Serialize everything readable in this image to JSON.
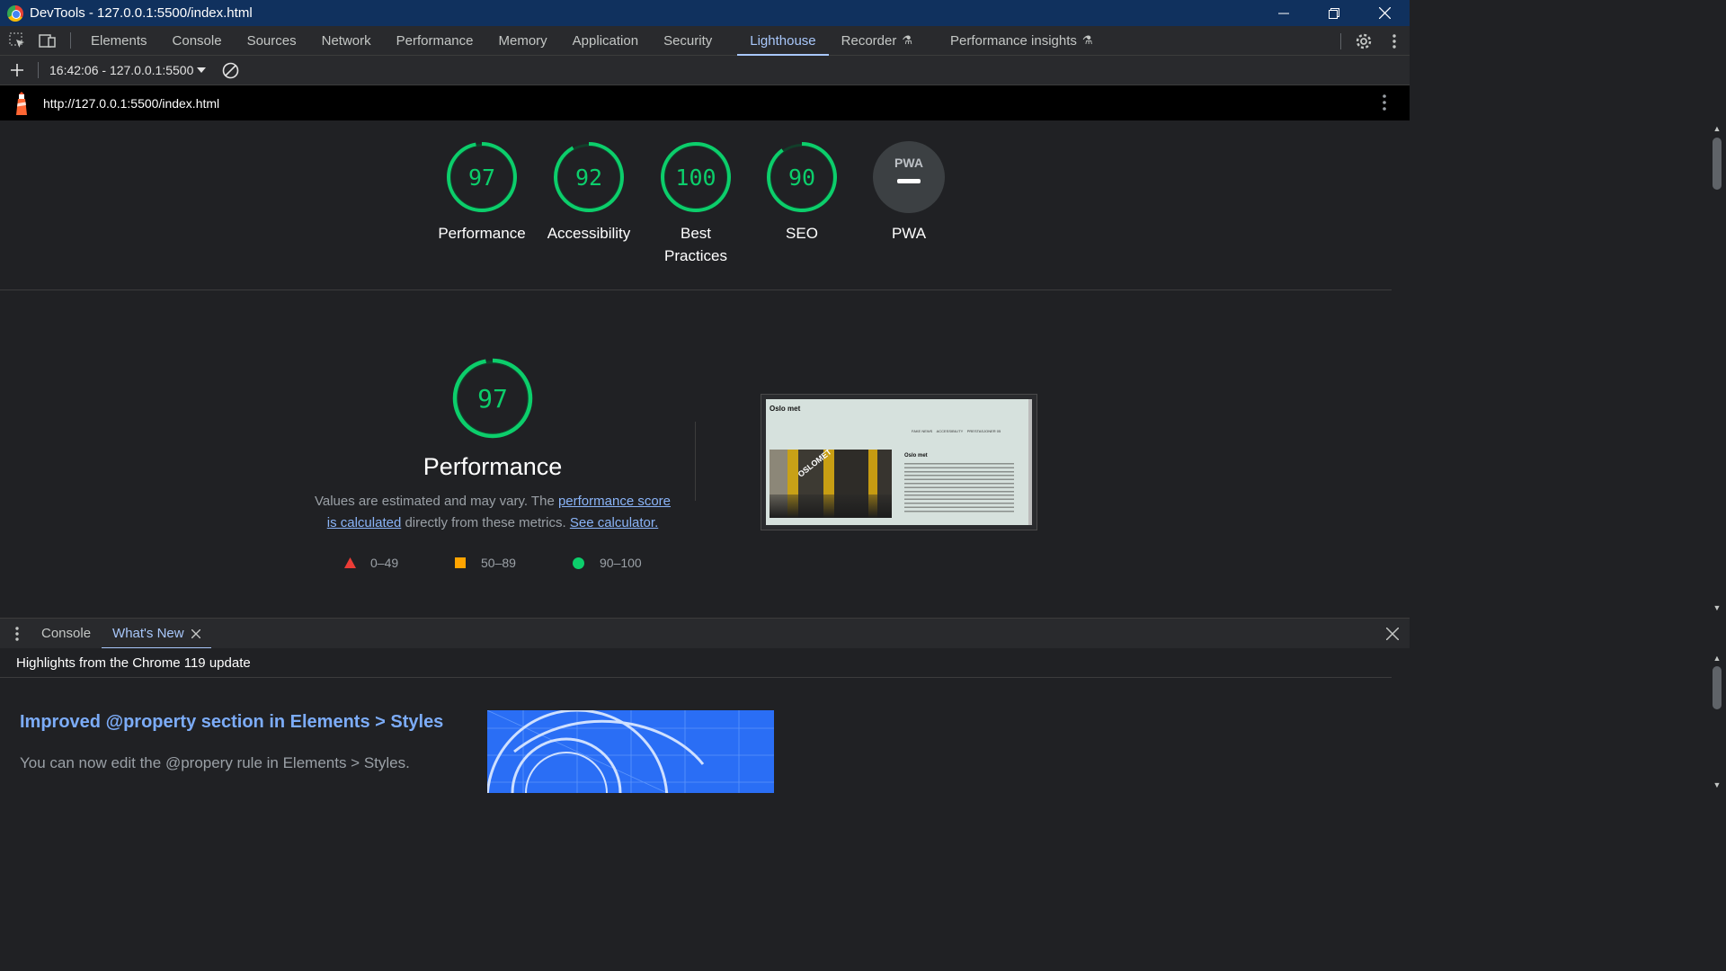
{
  "window": {
    "title": "DevTools - 127.0.0.1:5500/index.html"
  },
  "tabs": [
    {
      "label": "Elements"
    },
    {
      "label": "Console"
    },
    {
      "label": "Sources"
    },
    {
      "label": "Network"
    },
    {
      "label": "Performance"
    },
    {
      "label": "Memory"
    },
    {
      "label": "Application"
    },
    {
      "label": "Security"
    },
    {
      "label": "Lighthouse",
      "active": true
    },
    {
      "label": "Recorder"
    },
    {
      "label": "Performance insights"
    }
  ],
  "report_toolbar": {
    "report_selector": "16:42:06 - 127.0.0.1:5500"
  },
  "url_bar": {
    "url": "http://127.0.0.1:5500/index.html"
  },
  "scores": [
    {
      "value": "97",
      "label": "Performance",
      "score": 97
    },
    {
      "value": "92",
      "label": "Accessibility",
      "score": 92
    },
    {
      "value": "100",
      "label": "Best Practices",
      "label_line1": "Best",
      "label_line2": "Practices",
      "score": 100
    },
    {
      "value": "90",
      "label": "SEO",
      "score": 90
    },
    {
      "label": "PWA",
      "badge": "PWA"
    }
  ],
  "performance": {
    "score": "97",
    "score_value": 97,
    "title": "Performance",
    "desc_prefix": "Values are estimated and may vary. The ",
    "desc_link1_line1": "performance score",
    "desc_link1_line2": "is calculated",
    "desc_middle": " directly from these metrics. ",
    "desc_link2": "See calculator.",
    "legend": [
      {
        "range": "0–49",
        "shape": "triangle",
        "color": "#eb3c36"
      },
      {
        "range": "50–89",
        "shape": "square",
        "color": "#ffa400"
      },
      {
        "range": "90–100",
        "shape": "circle",
        "color": "#0cce6b"
      }
    ]
  },
  "screenshot_thumb": {
    "site_name": "Oslo met",
    "nav": "FAKE NEWS    ACCESSIBILITY    PRESTASJONER",
    "nav_extra": "05",
    "heading": "Oslo met",
    "badge_text": "OSLOMET"
  },
  "drawer": {
    "tabs": [
      {
        "label": "Console"
      },
      {
        "label": "What's New",
        "active": true
      }
    ],
    "highlights": "Highlights from the Chrome 119 update",
    "feature_title": "Improved @property section in Elements > Styles",
    "feature_text": "You can now edit the @propery rule in Elements > Styles."
  },
  "colors": {
    "pass": "#0cce6b",
    "accent": "#a8c7fa",
    "titlebar": "#10315e"
  }
}
